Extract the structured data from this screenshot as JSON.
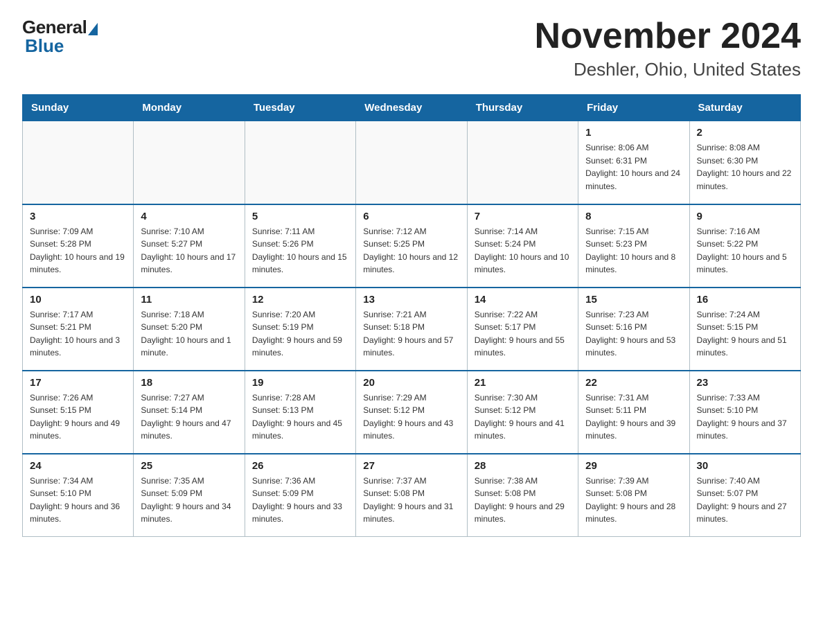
{
  "logo": {
    "general": "General",
    "blue": "Blue"
  },
  "title": "November 2024",
  "subtitle": "Deshler, Ohio, United States",
  "days_of_week": [
    "Sunday",
    "Monday",
    "Tuesday",
    "Wednesday",
    "Thursday",
    "Friday",
    "Saturday"
  ],
  "weeks": [
    [
      {
        "day": "",
        "sunrise": "",
        "sunset": "",
        "daylight": ""
      },
      {
        "day": "",
        "sunrise": "",
        "sunset": "",
        "daylight": ""
      },
      {
        "day": "",
        "sunrise": "",
        "sunset": "",
        "daylight": ""
      },
      {
        "day": "",
        "sunrise": "",
        "sunset": "",
        "daylight": ""
      },
      {
        "day": "",
        "sunrise": "",
        "sunset": "",
        "daylight": ""
      },
      {
        "day": "1",
        "sunrise": "Sunrise: 8:06 AM",
        "sunset": "Sunset: 6:31 PM",
        "daylight": "Daylight: 10 hours and 24 minutes."
      },
      {
        "day": "2",
        "sunrise": "Sunrise: 8:08 AM",
        "sunset": "Sunset: 6:30 PM",
        "daylight": "Daylight: 10 hours and 22 minutes."
      }
    ],
    [
      {
        "day": "3",
        "sunrise": "Sunrise: 7:09 AM",
        "sunset": "Sunset: 5:28 PM",
        "daylight": "Daylight: 10 hours and 19 minutes."
      },
      {
        "day": "4",
        "sunrise": "Sunrise: 7:10 AM",
        "sunset": "Sunset: 5:27 PM",
        "daylight": "Daylight: 10 hours and 17 minutes."
      },
      {
        "day": "5",
        "sunrise": "Sunrise: 7:11 AM",
        "sunset": "Sunset: 5:26 PM",
        "daylight": "Daylight: 10 hours and 15 minutes."
      },
      {
        "day": "6",
        "sunrise": "Sunrise: 7:12 AM",
        "sunset": "Sunset: 5:25 PM",
        "daylight": "Daylight: 10 hours and 12 minutes."
      },
      {
        "day": "7",
        "sunrise": "Sunrise: 7:14 AM",
        "sunset": "Sunset: 5:24 PM",
        "daylight": "Daylight: 10 hours and 10 minutes."
      },
      {
        "day": "8",
        "sunrise": "Sunrise: 7:15 AM",
        "sunset": "Sunset: 5:23 PM",
        "daylight": "Daylight: 10 hours and 8 minutes."
      },
      {
        "day": "9",
        "sunrise": "Sunrise: 7:16 AM",
        "sunset": "Sunset: 5:22 PM",
        "daylight": "Daylight: 10 hours and 5 minutes."
      }
    ],
    [
      {
        "day": "10",
        "sunrise": "Sunrise: 7:17 AM",
        "sunset": "Sunset: 5:21 PM",
        "daylight": "Daylight: 10 hours and 3 minutes."
      },
      {
        "day": "11",
        "sunrise": "Sunrise: 7:18 AM",
        "sunset": "Sunset: 5:20 PM",
        "daylight": "Daylight: 10 hours and 1 minute."
      },
      {
        "day": "12",
        "sunrise": "Sunrise: 7:20 AM",
        "sunset": "Sunset: 5:19 PM",
        "daylight": "Daylight: 9 hours and 59 minutes."
      },
      {
        "day": "13",
        "sunrise": "Sunrise: 7:21 AM",
        "sunset": "Sunset: 5:18 PM",
        "daylight": "Daylight: 9 hours and 57 minutes."
      },
      {
        "day": "14",
        "sunrise": "Sunrise: 7:22 AM",
        "sunset": "Sunset: 5:17 PM",
        "daylight": "Daylight: 9 hours and 55 minutes."
      },
      {
        "day": "15",
        "sunrise": "Sunrise: 7:23 AM",
        "sunset": "Sunset: 5:16 PM",
        "daylight": "Daylight: 9 hours and 53 minutes."
      },
      {
        "day": "16",
        "sunrise": "Sunrise: 7:24 AM",
        "sunset": "Sunset: 5:15 PM",
        "daylight": "Daylight: 9 hours and 51 minutes."
      }
    ],
    [
      {
        "day": "17",
        "sunrise": "Sunrise: 7:26 AM",
        "sunset": "Sunset: 5:15 PM",
        "daylight": "Daylight: 9 hours and 49 minutes."
      },
      {
        "day": "18",
        "sunrise": "Sunrise: 7:27 AM",
        "sunset": "Sunset: 5:14 PM",
        "daylight": "Daylight: 9 hours and 47 minutes."
      },
      {
        "day": "19",
        "sunrise": "Sunrise: 7:28 AM",
        "sunset": "Sunset: 5:13 PM",
        "daylight": "Daylight: 9 hours and 45 minutes."
      },
      {
        "day": "20",
        "sunrise": "Sunrise: 7:29 AM",
        "sunset": "Sunset: 5:12 PM",
        "daylight": "Daylight: 9 hours and 43 minutes."
      },
      {
        "day": "21",
        "sunrise": "Sunrise: 7:30 AM",
        "sunset": "Sunset: 5:12 PM",
        "daylight": "Daylight: 9 hours and 41 minutes."
      },
      {
        "day": "22",
        "sunrise": "Sunrise: 7:31 AM",
        "sunset": "Sunset: 5:11 PM",
        "daylight": "Daylight: 9 hours and 39 minutes."
      },
      {
        "day": "23",
        "sunrise": "Sunrise: 7:33 AM",
        "sunset": "Sunset: 5:10 PM",
        "daylight": "Daylight: 9 hours and 37 minutes."
      }
    ],
    [
      {
        "day": "24",
        "sunrise": "Sunrise: 7:34 AM",
        "sunset": "Sunset: 5:10 PM",
        "daylight": "Daylight: 9 hours and 36 minutes."
      },
      {
        "day": "25",
        "sunrise": "Sunrise: 7:35 AM",
        "sunset": "Sunset: 5:09 PM",
        "daylight": "Daylight: 9 hours and 34 minutes."
      },
      {
        "day": "26",
        "sunrise": "Sunrise: 7:36 AM",
        "sunset": "Sunset: 5:09 PM",
        "daylight": "Daylight: 9 hours and 33 minutes."
      },
      {
        "day": "27",
        "sunrise": "Sunrise: 7:37 AM",
        "sunset": "Sunset: 5:08 PM",
        "daylight": "Daylight: 9 hours and 31 minutes."
      },
      {
        "day": "28",
        "sunrise": "Sunrise: 7:38 AM",
        "sunset": "Sunset: 5:08 PM",
        "daylight": "Daylight: 9 hours and 29 minutes."
      },
      {
        "day": "29",
        "sunrise": "Sunrise: 7:39 AM",
        "sunset": "Sunset: 5:08 PM",
        "daylight": "Daylight: 9 hours and 28 minutes."
      },
      {
        "day": "30",
        "sunrise": "Sunrise: 7:40 AM",
        "sunset": "Sunset: 5:07 PM",
        "daylight": "Daylight: 9 hours and 27 minutes."
      }
    ]
  ]
}
